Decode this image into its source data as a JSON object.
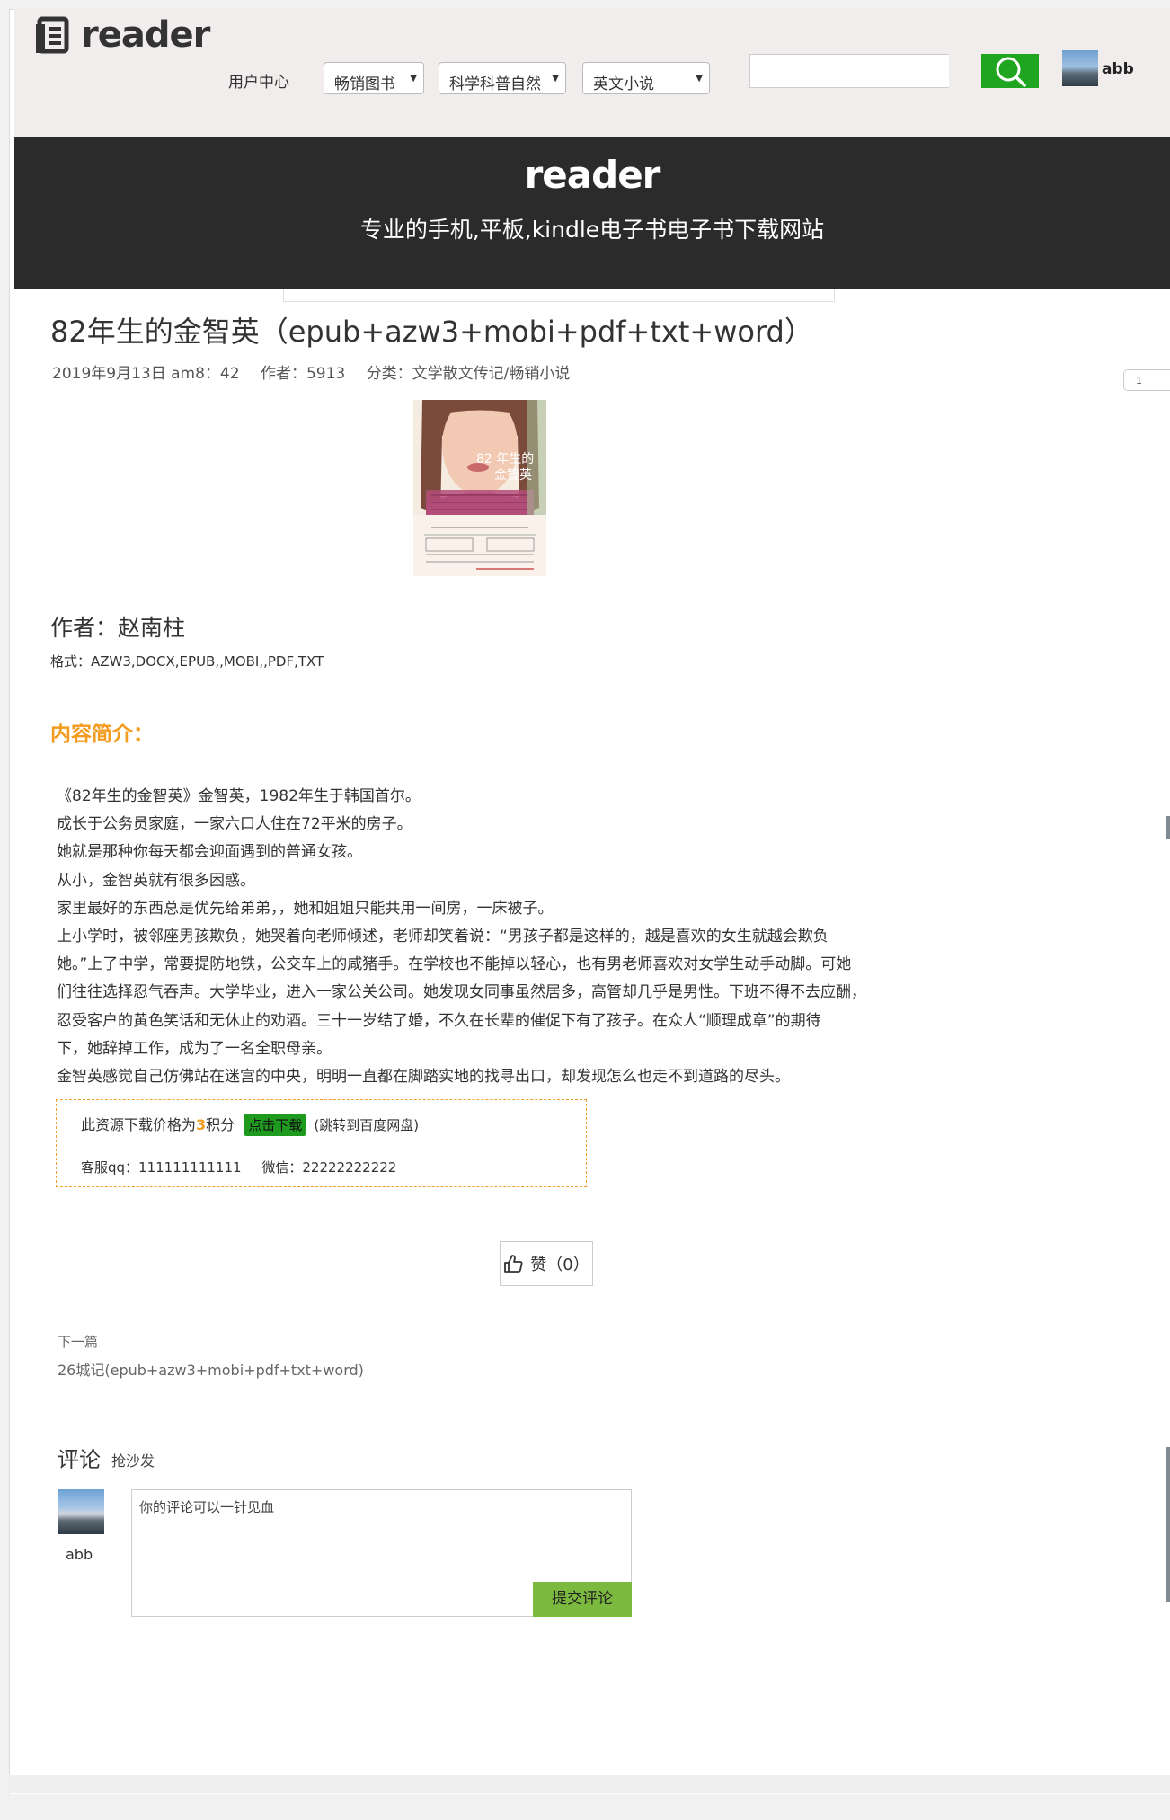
{
  "header": {
    "logo_text": "reader",
    "user_center": "用户中心",
    "dropdowns": [
      "畅销图书",
      "科学科普自然",
      "英文小说"
    ],
    "username": "abb"
  },
  "hero": {
    "logo_text": "reader",
    "subtitle": "专业的手机,平板,kindle电子书电子书下载网站"
  },
  "article": {
    "title": "82年生的金智英（epub+azw3+mobi+pdf+txt+word）",
    "date": "2019年9月13日 am8：42",
    "author_meta": "作者：5913",
    "category": "分类：文学散文传记/畅销小说",
    "page_indicator": "1",
    "cover": {
      "title_line1": "82 年生的",
      "title_line2": "金智英"
    },
    "author": "作者：赵南柱",
    "formats": "格式：AZW3,DOCX,EPUB,,MOBI,,PDF,TXT",
    "intro_heading": "内容简介：",
    "intro_lines": [
      "《82年生的金智英》金智英，1982年生于韩国首尔。",
      "成长于公务员家庭，一家六口人住在72平米的房子。",
      "她就是那种你每天都会迎面遇到的普通女孩。",
      "从小，金智英就有很多困惑。",
      "家里最好的东西总是优先给弟弟，，她和姐姐只能共用一间房，一床被子。",
      "上小学时，被邻座男孩欺负，她哭着向老师倾述，老师却笑着说：“男孩子都是这样的，越是喜欢的女生就越会欺负",
      "她。”上了中学，常要提防地铁，公交车上的咸猪手。在学校也不能掉以轻心，也有男老师喜欢对女学生动手动脚。可她",
      "们往往选择忍气吞声。大学毕业，进入一家公关公司。她发现女同事虽然居多，高管却几乎是男性。下班不得不去应酬，",
      "忍受客户的黄色笑话和无休止的劝酒。三十一岁结了婚，不久在长辈的催促下有了孩子。在众人“顺理成章”的期待",
      "下，她辞掉工作，成为了一名全职母亲。",
      "金智英感觉自己仿佛站在迷宫的中央，明明一直都在脚踏实地的找寻出口，却发现怎么也走不到道路的尽头。"
    ]
  },
  "download": {
    "price_prefix": "此资源下载价格为",
    "price_points": "3",
    "price_suffix": "积分",
    "button_label": "点击下载",
    "note": "(跳转到百度网盘)",
    "qq": "客服qq：111111111111",
    "wechat": "微信：22222222222"
  },
  "like": {
    "label": "赞（0）"
  },
  "next": {
    "label": "下一篇",
    "title": "26城记(epub+azw3+mobi+pdf+txt+word)"
  },
  "comments": {
    "title": "评论",
    "subtitle": "抢沙发",
    "username": "abb",
    "placeholder": "你的评论可以一针见血",
    "submit_label": "提交评论"
  },
  "colors": {
    "accent_orange": "#f39c1f",
    "download_green": "#1e9b1e",
    "search_green": "#1fa51f",
    "submit_green": "#7cba3f",
    "hero_bg": "#2b2b2b"
  }
}
